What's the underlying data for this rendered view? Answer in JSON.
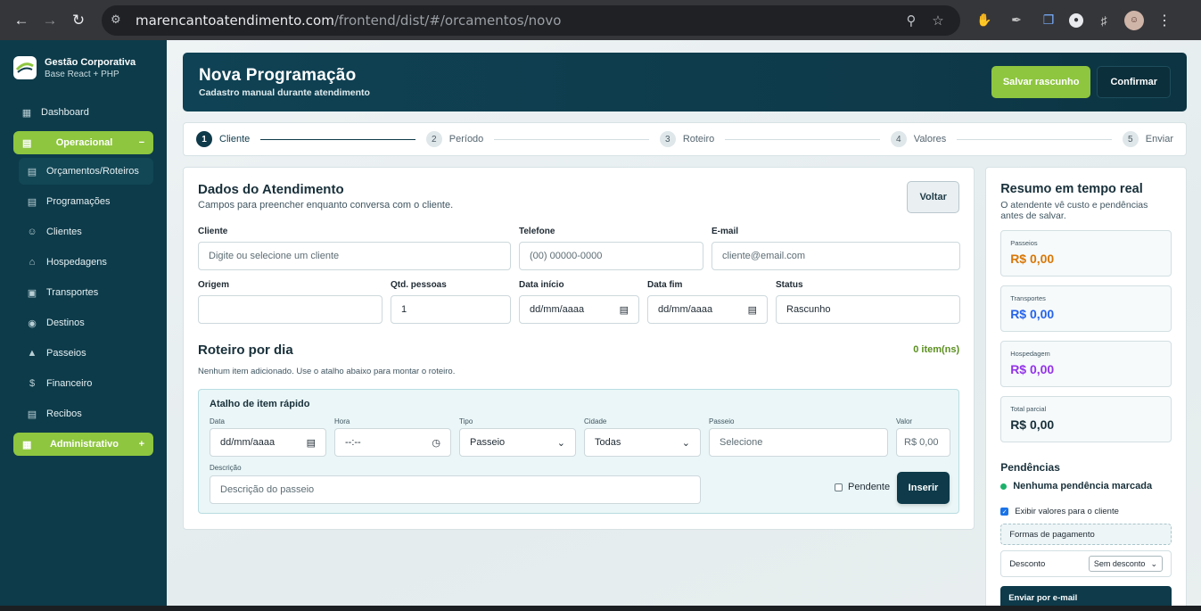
{
  "browser": {
    "url_host": "marencantoatendimento.com",
    "url_path": "/frontend/dist/#/orcamentos/novo"
  },
  "sidebar": {
    "brand_title": "Gestão Corporativa",
    "brand_sub": "Base React + PHP",
    "dashboard": "Dashboard",
    "operacional": "Operacional",
    "operacional_toggle": "−",
    "items": [
      "Orçamentos/Roteiros",
      "Programações",
      "Clientes",
      "Hospedagens",
      "Transportes",
      "Destinos",
      "Passeios",
      "Financeiro",
      "Recibos"
    ],
    "administrativo": "Administrativo",
    "administrativo_toggle": "+"
  },
  "header": {
    "title": "Nova Programação",
    "subtitle": "Cadastro manual durante atendimento",
    "save_draft": "Salvar rascunho",
    "confirm": "Confirmar"
  },
  "steps": [
    {
      "num": "1",
      "label": "Cliente"
    },
    {
      "num": "2",
      "label": "Período"
    },
    {
      "num": "3",
      "label": "Roteiro"
    },
    {
      "num": "4",
      "label": "Valores"
    },
    {
      "num": "5",
      "label": "Enviar"
    }
  ],
  "form": {
    "title": "Dados do Atendimento",
    "subtitle": "Campos para preencher enquanto conversa com o cliente.",
    "back": "Voltar",
    "cliente_label": "Cliente",
    "cliente_placeholder": "Digite ou selecione um cliente",
    "telefone_label": "Telefone",
    "telefone_placeholder": "(00) 00000-0000",
    "email_label": "E-mail",
    "email_placeholder": "cliente@email.com",
    "origem_label": "Origem",
    "origem_value": "",
    "qtd_label": "Qtd. pessoas",
    "qtd_value": "1",
    "data_inicio_label": "Data início",
    "data_inicio_value": "dd/mm/aaaa",
    "data_fim_label": "Data fim",
    "data_fim_value": "dd/mm/aaaa",
    "status_label": "Status",
    "status_value": "Rascunho"
  },
  "roteiro": {
    "title": "Roteiro por dia",
    "count": "0 item(ns)",
    "empty": "Nenhum item adicionado. Use o atalho abaixo para montar o roteiro."
  },
  "quick": {
    "title": "Atalho de item rápido",
    "data_label": "Data",
    "data_value": "dd/mm/aaaa",
    "hora_label": "Hora",
    "hora_value": "--:--",
    "tipo_label": "Tipo",
    "tipo_value": "Passeio",
    "cidade_label": "Cidade",
    "cidade_value": "Todas",
    "passeio_label": "Passeio",
    "passeio_placeholder": "Selecione",
    "valor_label": "Valor",
    "valor_placeholder": "R$ 0,00",
    "descricao_label": "Descrição",
    "descricao_placeholder": "Descrição do passeio",
    "pendente": "Pendente",
    "insert": "Inserir"
  },
  "summary": {
    "title": "Resumo em tempo real",
    "subtitle": "O atendente vê custo e pendências antes de salvar.",
    "boxes": [
      {
        "label": "Passeios",
        "value": "R$ 0,00",
        "color": "#d97706"
      },
      {
        "label": "Transportes",
        "value": "R$ 0,00",
        "color": "#2563eb"
      },
      {
        "label": "Hospedagem",
        "value": "R$ 0,00",
        "color": "#9333ea"
      },
      {
        "label": "Total parcial",
        "value": "R$ 0,00",
        "color": "#18303a"
      }
    ],
    "pendencias_title": "Pendências",
    "pendencias_item": "Nenhuma pendência marcada",
    "show_values": "Exibir valores para o cliente",
    "payment": "Formas de pagamento",
    "discount_label": "Desconto",
    "discount_value": "Sem desconto",
    "send_email": "Enviar por e-mail"
  }
}
